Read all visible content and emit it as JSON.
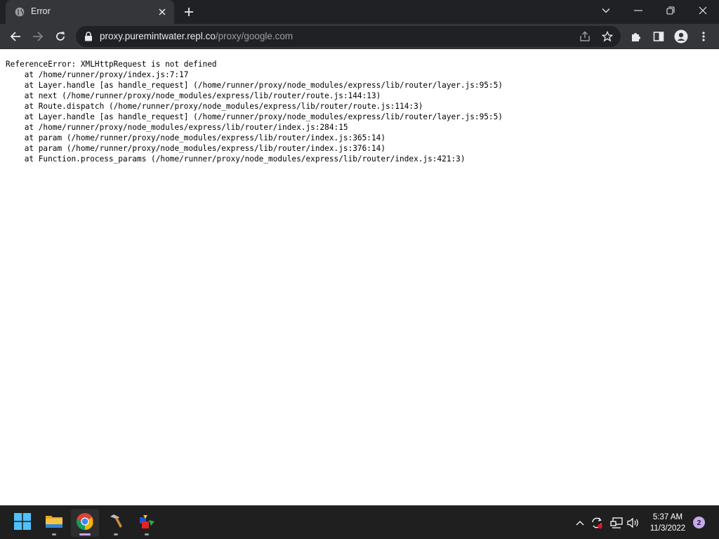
{
  "browser": {
    "tab": {
      "title": "Error",
      "favicon": "globe-icon"
    },
    "omnibox": {
      "host": "proxy.puremintwater.repl.co",
      "path": "/proxy/google.com"
    }
  },
  "page": {
    "stack_trace": "ReferenceError: XMLHttpRequest is not defined\n    at /home/runner/proxy/index.js:7:17\n    at Layer.handle [as handle_request] (/home/runner/proxy/node_modules/express/lib/router/layer.js:95:5)\n    at next (/home/runner/proxy/node_modules/express/lib/router/route.js:144:13)\n    at Route.dispatch (/home/runner/proxy/node_modules/express/lib/router/route.js:114:3)\n    at Layer.handle [as handle_request] (/home/runner/proxy/node_modules/express/lib/router/layer.js:95:5)\n    at /home/runner/proxy/node_modules/express/lib/router/index.js:284:15\n    at param (/home/runner/proxy/node_modules/express/lib/router/index.js:365:14)\n    at param (/home/runner/proxy/node_modules/express/lib/router/index.js:376:14)\n    at Function.process_params (/home/runner/proxy/node_modules/express/lib/router/index.js:421:3)"
  },
  "taskbar": {
    "apps": [
      "start-icon",
      "file-explorer-icon",
      "chrome-icon",
      "tool-icon",
      "paint-icon"
    ],
    "active_app": "chrome-icon",
    "clock": {
      "time": "5:37 AM",
      "date": "11/3/2022"
    },
    "notification_count": "2"
  },
  "colors": {
    "tab_strip": "#202124",
    "toolbar": "#35363a",
    "omnibox": "#202124",
    "taskbar": "#1f1f1f",
    "accent": "#c9a7f0"
  }
}
